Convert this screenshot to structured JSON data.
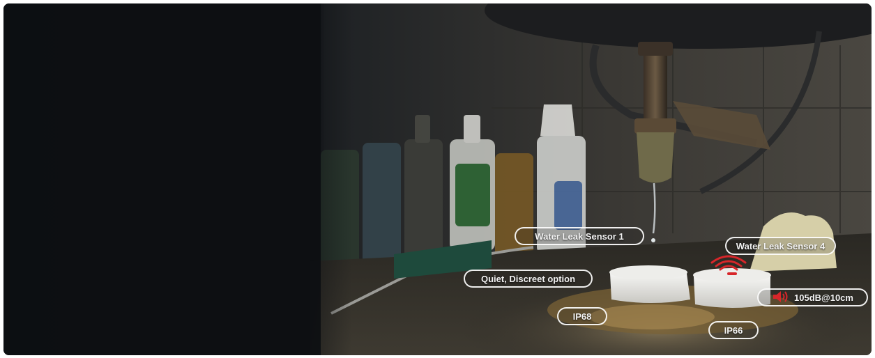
{
  "labels": {
    "sensor1": "Water Leak Sensor 1",
    "sensor4": "Water Leak Sensor 4",
    "quiet": "Quiet, Discreet option",
    "ip68": "IP68",
    "ip66": "IP66",
    "volume": "105dB@10cm"
  },
  "colors": {
    "background": "#0d0f12",
    "callout_border": "#ffffff",
    "alert_red": "#d8262a"
  },
  "icons": {
    "speaker": "speaker-icon",
    "signal": "wifi-signal-icon"
  }
}
